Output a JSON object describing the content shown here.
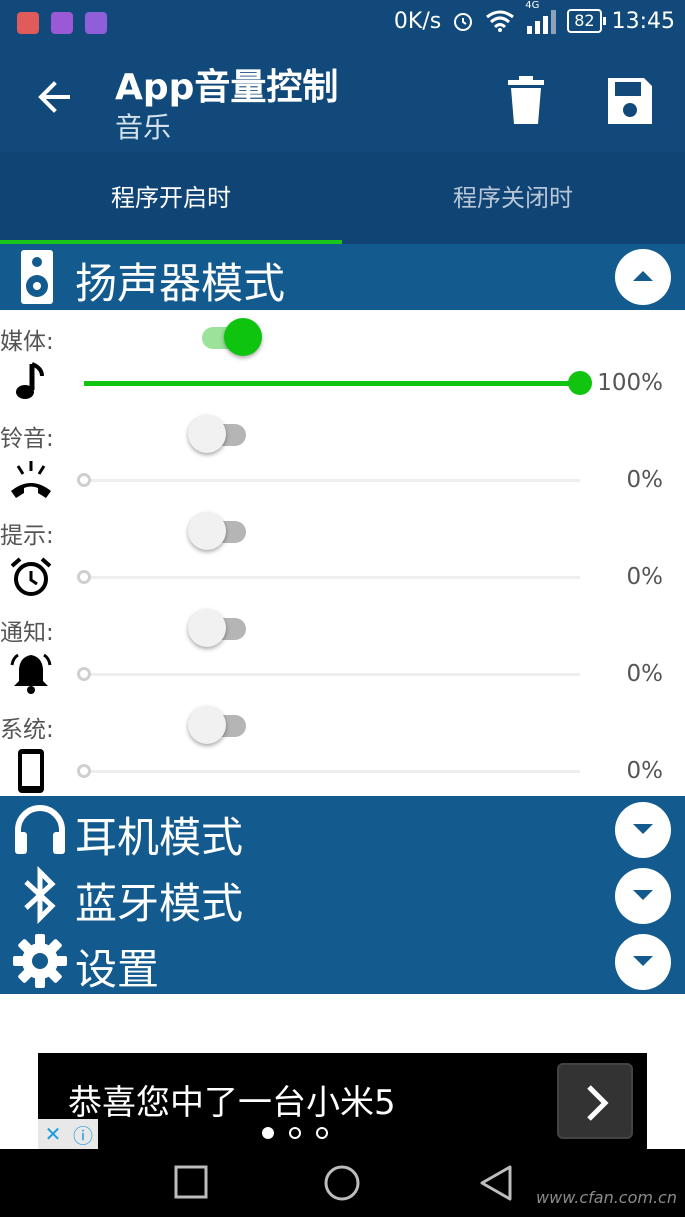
{
  "status_bar": {
    "speed": "0K/s",
    "network": "4G",
    "battery": "82",
    "time": "13:45"
  },
  "app_bar": {
    "title": "App音量控制",
    "subtitle": "音乐"
  },
  "tabs": [
    {
      "label": "程序开启时",
      "active": true
    },
    {
      "label": "程序关闭时",
      "active": false
    }
  ],
  "speaker_section": {
    "title": "扬声器模式",
    "rows": [
      {
        "label": "媒体:",
        "enabled": true,
        "level": 100,
        "percent_text": "100%",
        "icon": "music-note-icon"
      },
      {
        "label": "铃音:",
        "enabled": false,
        "level": 0,
        "percent_text": "0%",
        "icon": "ringing-phone-icon"
      },
      {
        "label": "提示:",
        "enabled": false,
        "level": 0,
        "percent_text": "0%",
        "icon": "alarm-clock-icon"
      },
      {
        "label": "通知:",
        "enabled": false,
        "level": 0,
        "percent_text": "0%",
        "icon": "bell-icon"
      },
      {
        "label": "系统:",
        "enabled": false,
        "level": 0,
        "percent_text": "0%",
        "icon": "phone-device-icon"
      }
    ]
  },
  "other_sections": [
    {
      "title": "耳机模式",
      "icon": "headphones-icon"
    },
    {
      "title": "蓝牙模式",
      "icon": "bluetooth-icon"
    },
    {
      "title": "设置",
      "icon": "gear-icon"
    }
  ],
  "ad": {
    "text": "恭喜您中了一台小米5",
    "pages": 3,
    "active_page": 1
  },
  "watermark": "www.cfan.com.cn",
  "colors": {
    "primary": "#114a7a",
    "section": "#135a8e",
    "accent": "#10c410"
  }
}
